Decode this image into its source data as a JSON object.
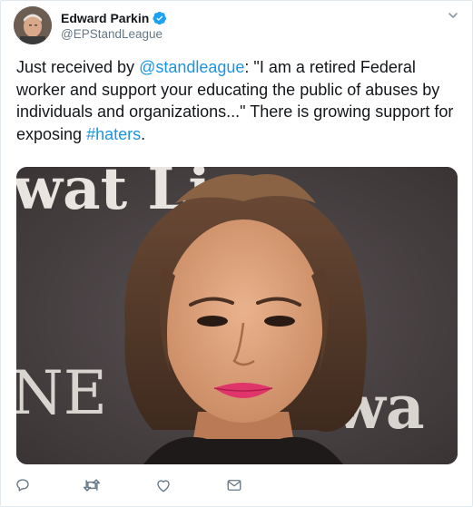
{
  "author": {
    "name": "Edward Parkin",
    "handle": "@EPStandLeague",
    "verified": true
  },
  "tweet": {
    "text_parts": [
      {
        "text": "Just received by ",
        "link": false
      },
      {
        "text": "@standleague",
        "link": true
      },
      {
        "text": ": \"I am a retired Federal worker and support your educating the public of abuses by individuals and organizations...\" There is growing support for exposing ",
        "link": false
      },
      {
        "text": "#haters",
        "link": true
      },
      {
        "text": ".",
        "link": false
      }
    ]
  },
  "media": {
    "backdrop_text_top": "wat  Line",
    "backdrop_text_left": "NE",
    "backdrop_text_right": "wa"
  },
  "actions": [
    {
      "name": "reply-icon"
    },
    {
      "name": "retweet-icon"
    },
    {
      "name": "like-icon"
    },
    {
      "name": "share-icon"
    }
  ],
  "colors": {
    "link": "#1b95e0",
    "verified": "#1da1f2",
    "secondary_text": "#657786",
    "border": "#e1e8ed"
  }
}
